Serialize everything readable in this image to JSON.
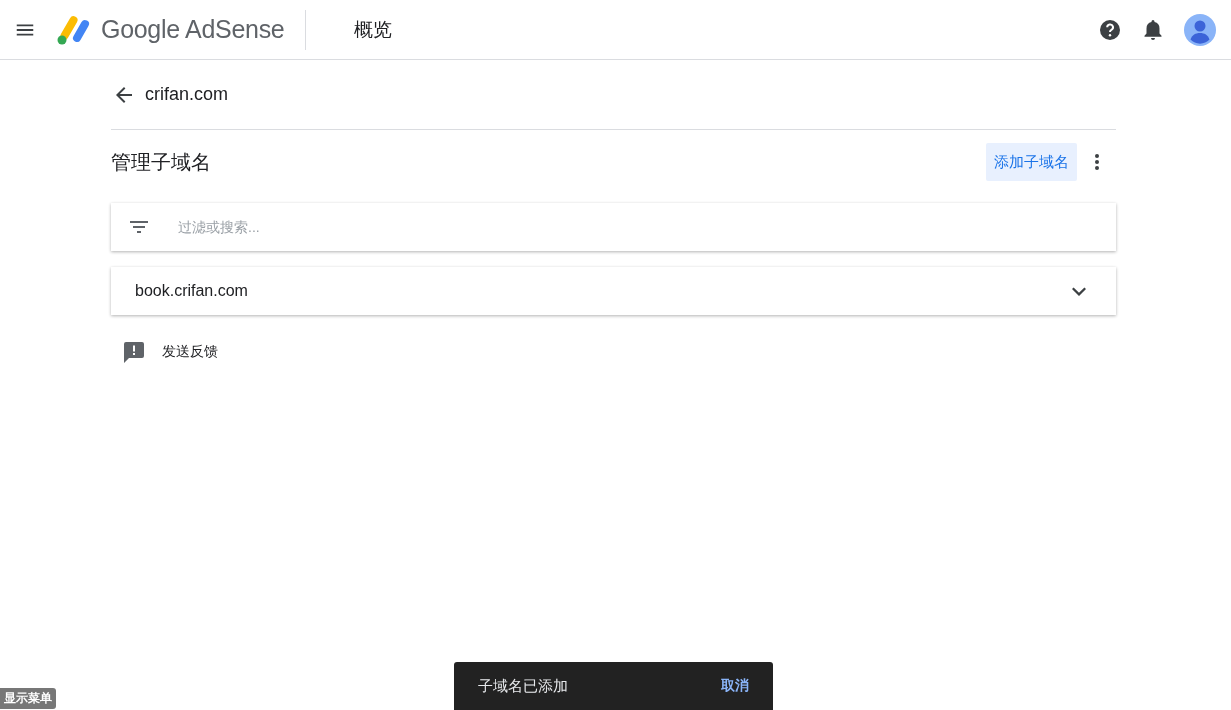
{
  "header": {
    "product_name": "Google AdSense",
    "page_title": "概览"
  },
  "site": {
    "name": "crifan.com"
  },
  "section": {
    "title": "管理子域名",
    "add_button": "添加子域名"
  },
  "search": {
    "placeholder": "过滤或搜索..."
  },
  "subdomains": [
    {
      "name": "book.crifan.com",
      "expanded": false
    }
  ],
  "feedback": {
    "label": "发送反馈"
  },
  "snackbar": {
    "message": "子域名已添加",
    "action": "取消"
  },
  "menu_tag": {
    "label": "显示菜单"
  }
}
